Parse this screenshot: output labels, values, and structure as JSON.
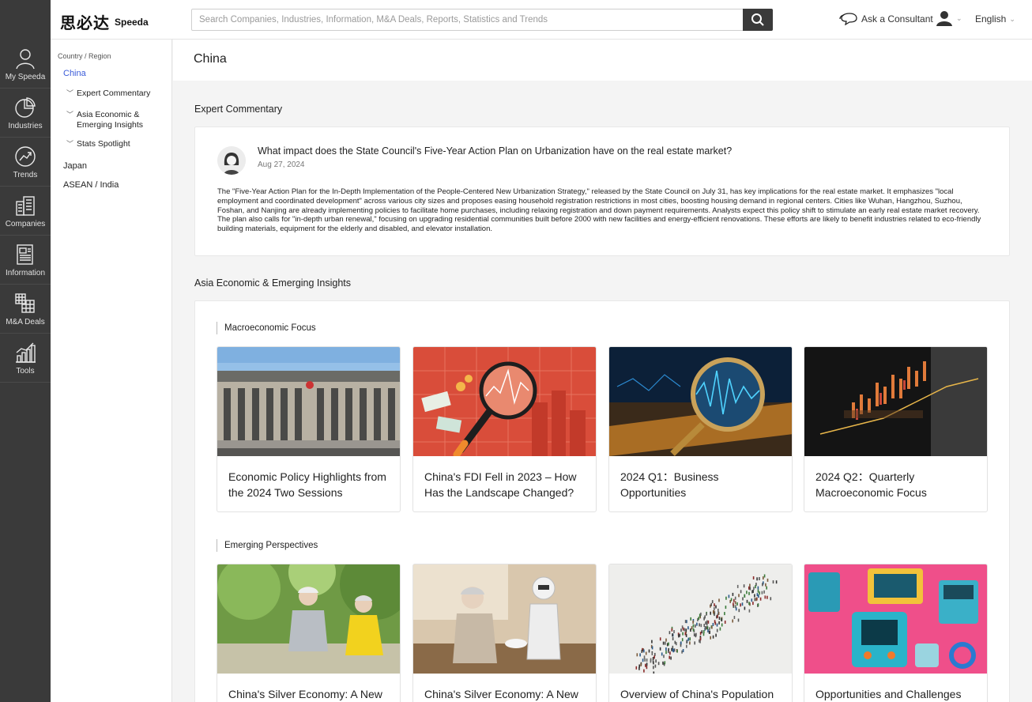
{
  "header": {
    "logo_cn": "思必达",
    "logo_en": "Speeda",
    "search_placeholder": "Search Companies, Industries, Information, M&A Deals, Reports, Statistics and Trends",
    "consultant_label": "Ask a Consultant",
    "language": "English"
  },
  "rail": {
    "items": [
      {
        "label": "My Speeda",
        "icon": "person-icon"
      },
      {
        "label": "Industries",
        "icon": "pie-chart-icon"
      },
      {
        "label": "Trends",
        "icon": "trend-icon"
      },
      {
        "label": "Companies",
        "icon": "buildings-icon"
      },
      {
        "label": "Information",
        "icon": "newspaper-icon"
      },
      {
        "label": "M&A Deals",
        "icon": "deals-grid-icon"
      },
      {
        "label": "Tools",
        "icon": "bar-chart-icon"
      }
    ]
  },
  "subnav": {
    "caption": "Country / Region",
    "active": "China",
    "children": [
      "Expert Commentary",
      "Asia Economic & Emerging Insights",
      "Stats Spotlight"
    ],
    "others": [
      "Japan",
      "ASEAN / India"
    ]
  },
  "page": {
    "title": "China"
  },
  "expert": {
    "heading": "Expert Commentary",
    "question": "What impact does the State Council's Five-Year Action Plan on Urbanization have on the real estate market?",
    "date": "Aug 27, 2024",
    "body": "The \"Five-Year Action Plan for the In-Depth Implementation of the People-Centered New Urbanization Strategy,\" released by the State Council on July 31, has key implications for the real estate market. It emphasizes \"local employment and coordinated development\" across various city sizes and proposes easing household registration restrictions in most cities, boosting housing demand in regional centers. Cities like Wuhan, Hangzhou, Suzhou, Foshan, and Nanjing are already implementing policies to facilitate home purchases, including relaxing registration and down payment requirements. Analysts expect this policy shift to stimulate an early real estate market recovery. The plan also calls for \"in-depth urban renewal,\" focusing on upgrading residential communities built before 2000 with new facilities and energy-efficient renovations. These efforts are likely to benefit industries related to eco-friendly building materials, equipment for the elderly and disabled, and elevator installation."
  },
  "insights": {
    "heading": "Asia Economic & Emerging Insights",
    "macro_heading": "Macroeconomic Focus",
    "macro_tiles": [
      {
        "title": "Economic Policy Highlights from the 2024 Two Sessions"
      },
      {
        "title": "China's FDI Fell in 2023 – How Has the Landscape Changed?"
      },
      {
        "title": "2024 Q1：Business Opportunities"
      },
      {
        "title": "2024 Q2：Quarterly Macroeconomic Focus"
      }
    ],
    "emerging_heading": "Emerging Perspectives",
    "emerging_tiles": [
      {
        "title": "China's Silver Economy: A New"
      },
      {
        "title": "China's Silver Economy: A New"
      },
      {
        "title": "Overview of China's Population"
      },
      {
        "title": "Opportunities and Challenges"
      }
    ]
  }
}
